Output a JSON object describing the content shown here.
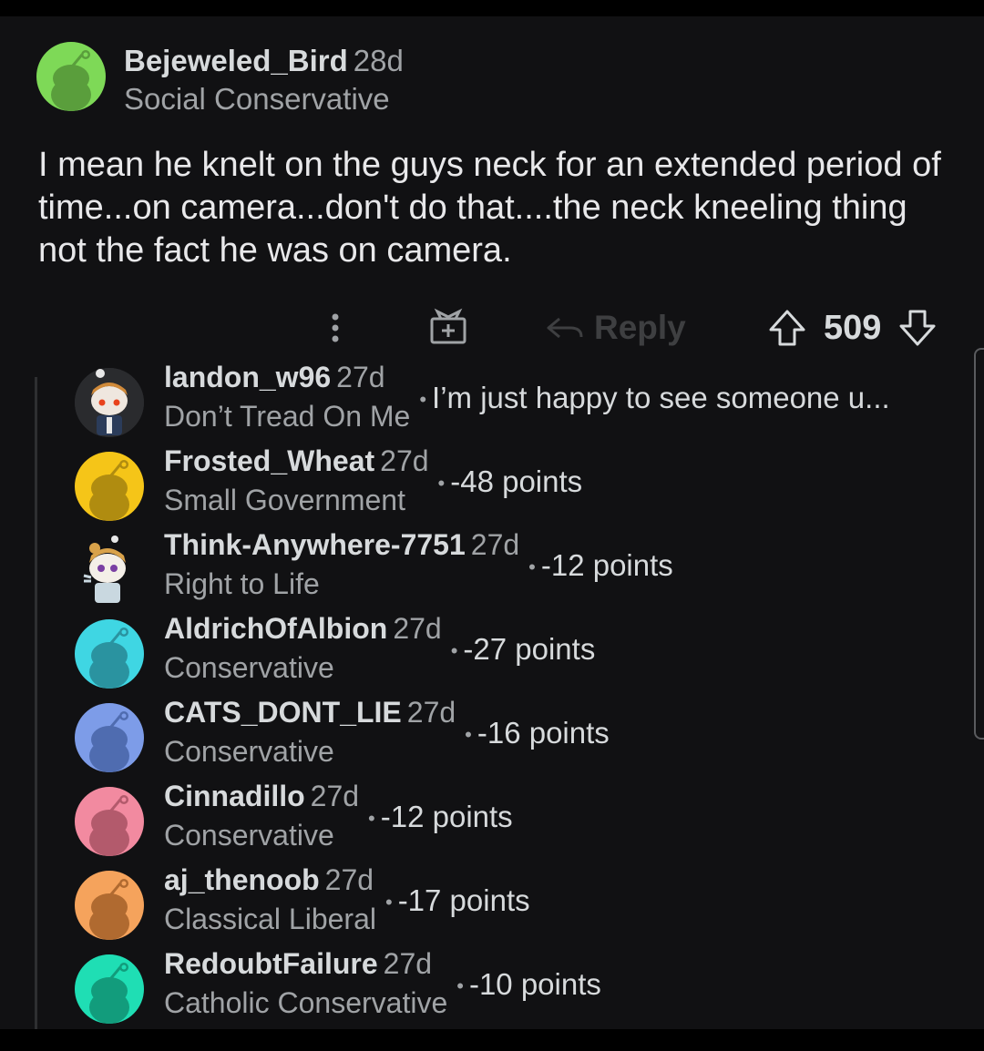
{
  "post": {
    "username": "Bejeweled_Bird",
    "age": "28d",
    "flair": "Social Conservative",
    "body": "I mean he knelt on the guys neck for an extended period of time...on camera...don't do that....the neck kneeling thing not the fact he was on camera.",
    "avatar_color": "#7ed957"
  },
  "actions": {
    "more_icon": "vertical-dots-icon",
    "gift_icon": "gift-icon",
    "reply_label": "Reply",
    "score": "509"
  },
  "replies": [
    {
      "username": "landon_w96",
      "age": "27d",
      "flair": "Don’t Tread On Me",
      "snippet": "I’m just happy to see someone u...",
      "avatar_color": "#e8e0d8"
    },
    {
      "username": "Frosted_Wheat",
      "age": "27d",
      "flair": "Small Government",
      "snippet": "-48 points",
      "avatar_color": "#f5c518"
    },
    {
      "username": "Think-Anywhere-7751",
      "age": "27d",
      "flair": "Right to Life",
      "snippet": "-12 points",
      "avatar_color": "#ffffff"
    },
    {
      "username": "AldrichOfAlbion",
      "age": "27d",
      "flair": "Conservative",
      "snippet": "-27 points",
      "avatar_color": "#3fd6e3"
    },
    {
      "username": "CATS_DONT_LIE",
      "age": "27d",
      "flair": "Conservative",
      "snippet": "-16 points",
      "avatar_color": "#7d9ce8"
    },
    {
      "username": "Cinnadillo",
      "age": "27d",
      "flair": "Conservative",
      "snippet": "-12 points",
      "avatar_color": "#f28aa0"
    },
    {
      "username": "aj_thenoob",
      "age": "27d",
      "flair": "Classical Liberal",
      "snippet": "-17 points",
      "avatar_color": "#f5a35c"
    },
    {
      "username": "RedoubtFailure",
      "age": "27d",
      "flair": "Catholic Conservative",
      "snippet": "-10 points",
      "avatar_color": "#1fdeb4"
    }
  ]
}
